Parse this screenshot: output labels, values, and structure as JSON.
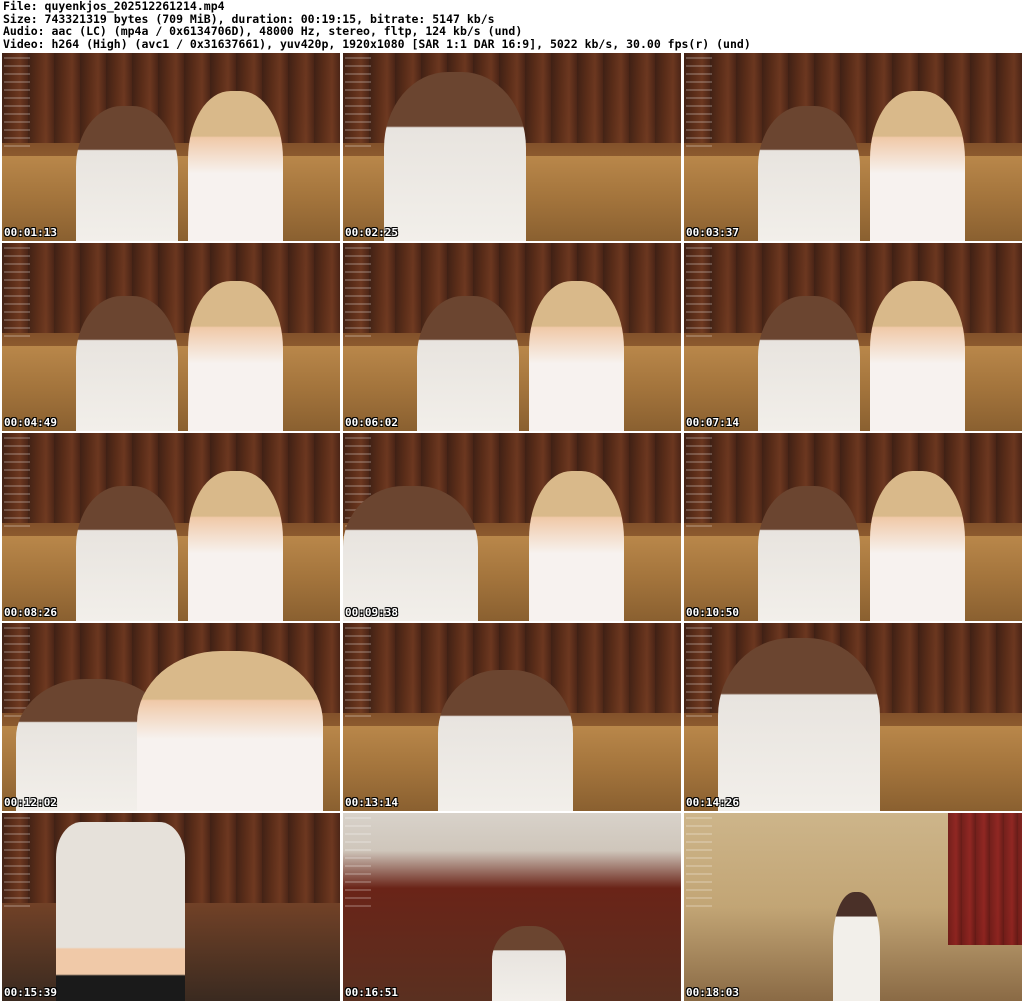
{
  "header": {
    "file_line": "File: quyenkjos_202512261214.mp4",
    "size_line": "Size: 743321319 bytes (709 MiB), duration: 00:19:15, bitrate: 5147 kb/s",
    "audio_line": "Audio: aac (LC) (mp4a / 0x6134706D), 48000 Hz, stereo, fltp, 124 kb/s (und)",
    "video_line": "Video: h264 (High) (avc1 / 0x31637661), yuv420p, 1920x1080 [SAR 1:1 DAR 16:9], 5022 kb/s, 30.00 fps(r) (und)"
  },
  "thumbnails": [
    {
      "timestamp": "00:01:13"
    },
    {
      "timestamp": "00:02:25"
    },
    {
      "timestamp": "00:03:37"
    },
    {
      "timestamp": "00:04:49"
    },
    {
      "timestamp": "00:06:02"
    },
    {
      "timestamp": "00:07:14"
    },
    {
      "timestamp": "00:08:26"
    },
    {
      "timestamp": "00:09:38"
    },
    {
      "timestamp": "00:10:50"
    },
    {
      "timestamp": "00:12:02"
    },
    {
      "timestamp": "00:13:14"
    },
    {
      "timestamp": "00:14:26"
    },
    {
      "timestamp": "00:15:39"
    },
    {
      "timestamp": "00:16:51"
    },
    {
      "timestamp": "00:18:03"
    }
  ]
}
